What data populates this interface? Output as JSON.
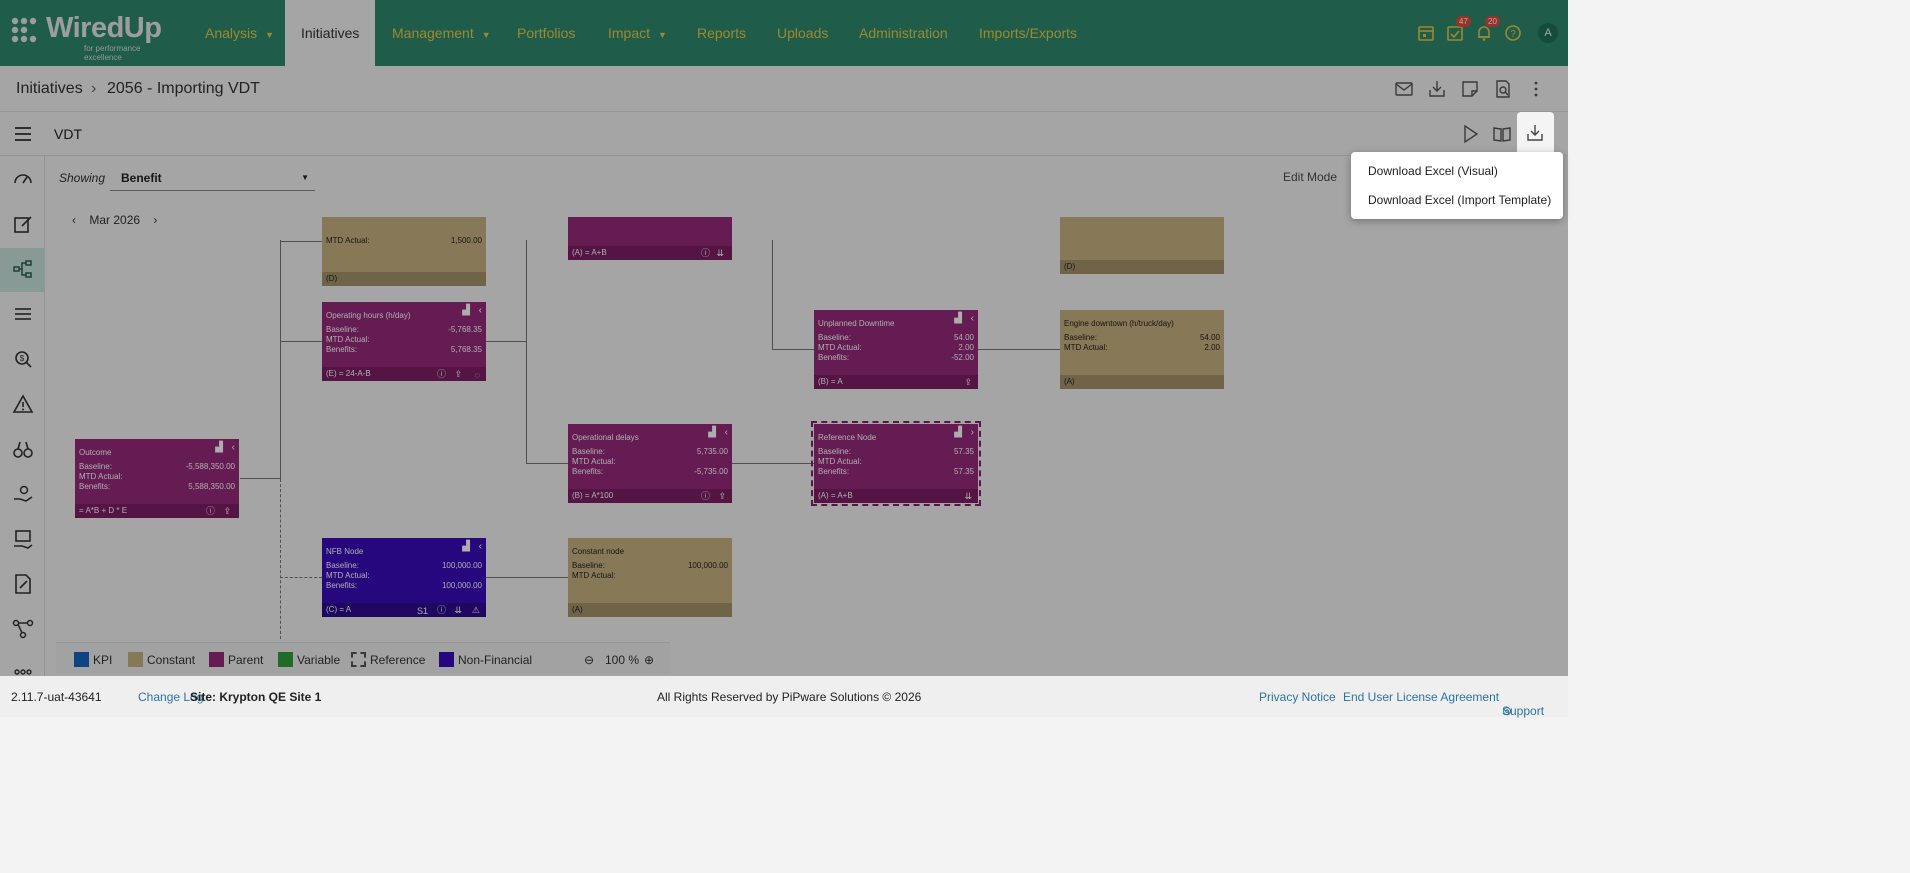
{
  "app": {
    "logo_word": "WiredUp",
    "logo_tagline": "for performance excellence"
  },
  "nav": {
    "items": [
      {
        "label": "Analysis",
        "caret": "▼"
      },
      {
        "label": "Initiatives"
      },
      {
        "label": "Management",
        "caret": "▼"
      },
      {
        "label": "Portfolios"
      },
      {
        "label": "Impact",
        "caret": "▼"
      },
      {
        "label": "Reports"
      },
      {
        "label": "Uploads"
      },
      {
        "label": "Administration"
      },
      {
        "label": "Imports/Exports"
      }
    ],
    "badge_tasks": "47",
    "badge_notifications": "20",
    "avatar": "A",
    "icons": [
      "calendar-icon",
      "tasks-icon",
      "bell-icon",
      "help-icon"
    ]
  },
  "breadcrumb": {
    "root": "Initiatives",
    "separator": "›",
    "current": "2056 - Importing VDT"
  },
  "vdt": {
    "title": "VDT"
  },
  "controls": {
    "showing_label": "Showing",
    "showing_value": "Benefit",
    "date": "Mar 2026",
    "prev": "‹",
    "next": "›",
    "edit_mode": "Edit Mode"
  },
  "menu": {
    "items": [
      "Download Excel (Visual)",
      "Download Excel (Import Template)"
    ]
  },
  "nodes": {
    "top_const": {
      "mtd_label": "MTD Actual:",
      "mtd": "1,500.00",
      "formula": "(D)"
    },
    "top_parent": {
      "formula": "(A) = A+B"
    },
    "top_right_const": {
      "formula": "(D)"
    },
    "op_hours": {
      "title": "Operating hours (h/day)",
      "baseline": "-5,768.35",
      "mtd": "",
      "benefits": "5,768.35",
      "formula": "(E) = 24-A-B"
    },
    "unplanned": {
      "title": "Unplanned Downtime",
      "baseline": "54.00",
      "mtd": "2.00",
      "benefits": "-52.00",
      "formula": "(B) = A"
    },
    "engine": {
      "title": "Engine downtown (h/truck/day)",
      "baseline": "54.00",
      "mtd": "2.00",
      "formula": "(A)"
    },
    "opdelays": {
      "title": "Operational delays",
      "baseline": "5,735.00",
      "mtd": "",
      "benefits": "-5,735.00",
      "formula": "(B) = A*100"
    },
    "reference": {
      "title": "Reference Node",
      "baseline": "57.35",
      "mtd": "",
      "benefits": "57.35",
      "formula": "(A) = A+B"
    },
    "outcome": {
      "title": "Outcome",
      "baseline": "-5,588,350.00",
      "mtd": "",
      "benefits": "5,588,350.00",
      "formula": "= A*B + D * E"
    },
    "nfb": {
      "title": "NFB Node",
      "baseline": "100,000.00",
      "mtd": "",
      "benefits": "100,000.00",
      "formula": "(C) = A",
      "tag": "S1"
    },
    "constant": {
      "title": "Constant node",
      "baseline": "100,000.00",
      "mtd": "",
      "formula": "(A)"
    },
    "labels": {
      "baseline": "Baseline:",
      "mtd": "MTD Actual:",
      "benefits": "Benefits:"
    }
  },
  "legend": {
    "items": [
      {
        "label": "KPI",
        "color": "#1565c0"
      },
      {
        "label": "Constant",
        "color": "#c7b280"
      },
      {
        "label": "Parent",
        "color": "#962a7a"
      },
      {
        "label": "Variable",
        "color": "#2e9e3a"
      },
      {
        "label": "Reference",
        "color": "dashed"
      },
      {
        "label": "Non-Financial",
        "color": "#3a0bb8"
      }
    ],
    "zoom": "100 %"
  },
  "footer": {
    "version": "2.11.7-uat-43641",
    "changelog": "Change Log",
    "site": "Site: Krypton QE Site 1",
    "rights": "All Rights Reserved by PiPware Solutions © 2026",
    "privacy": "Privacy Notice",
    "eula": "End User License Agreement",
    "support": "Support"
  },
  "colors": {
    "nav_bg": "#2e8a6e",
    "nav_text": "#e7c94a",
    "parent": "#962a7a",
    "constant": "#c7b280",
    "nfb": "#3a0bb8"
  }
}
